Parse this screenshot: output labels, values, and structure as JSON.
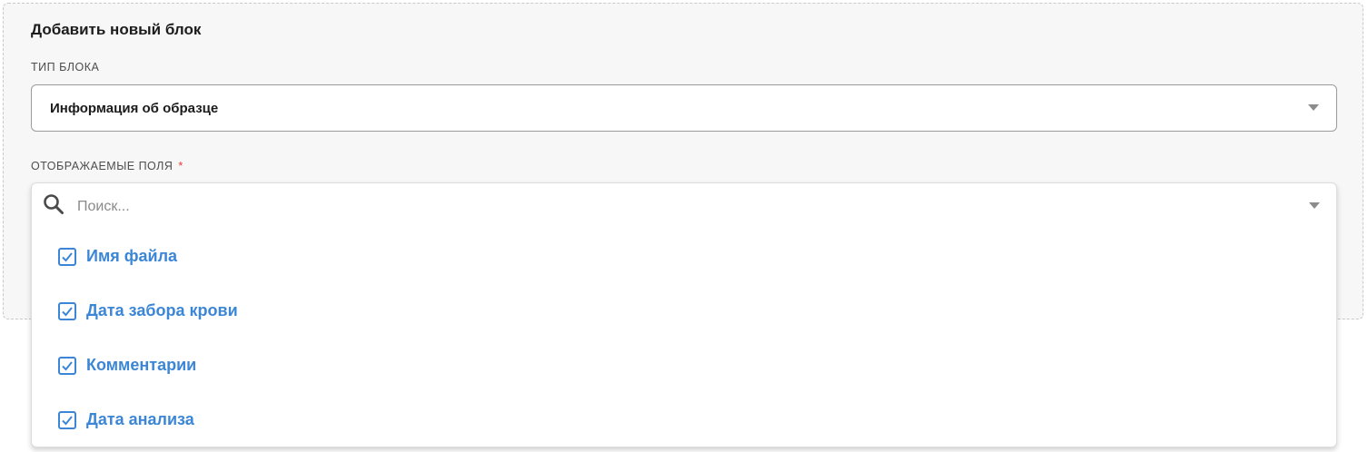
{
  "form": {
    "title": "Добавить новый блок",
    "block_type": {
      "label": "ТИП БЛОКА",
      "value": "Информация об образце"
    },
    "fields": {
      "label": "ОТОБРАЖАЕМЫЕ ПОЛЯ",
      "required_mark": "*",
      "search_placeholder": "Поиск...",
      "options": [
        {
          "label": "Имя файла",
          "checked": true
        },
        {
          "label": "Дата забора крови",
          "checked": true
        },
        {
          "label": "Комментарии",
          "checked": true
        },
        {
          "label": "Дата анализа",
          "checked": true
        }
      ]
    }
  },
  "colors": {
    "accent": "#3b86d6",
    "required": "#e53935",
    "panel_bg": "#f7f7f7"
  },
  "icons": {
    "search": "search-icon",
    "dropdown": "chevron-down-icon",
    "checkbox": "checkmark-icon"
  }
}
